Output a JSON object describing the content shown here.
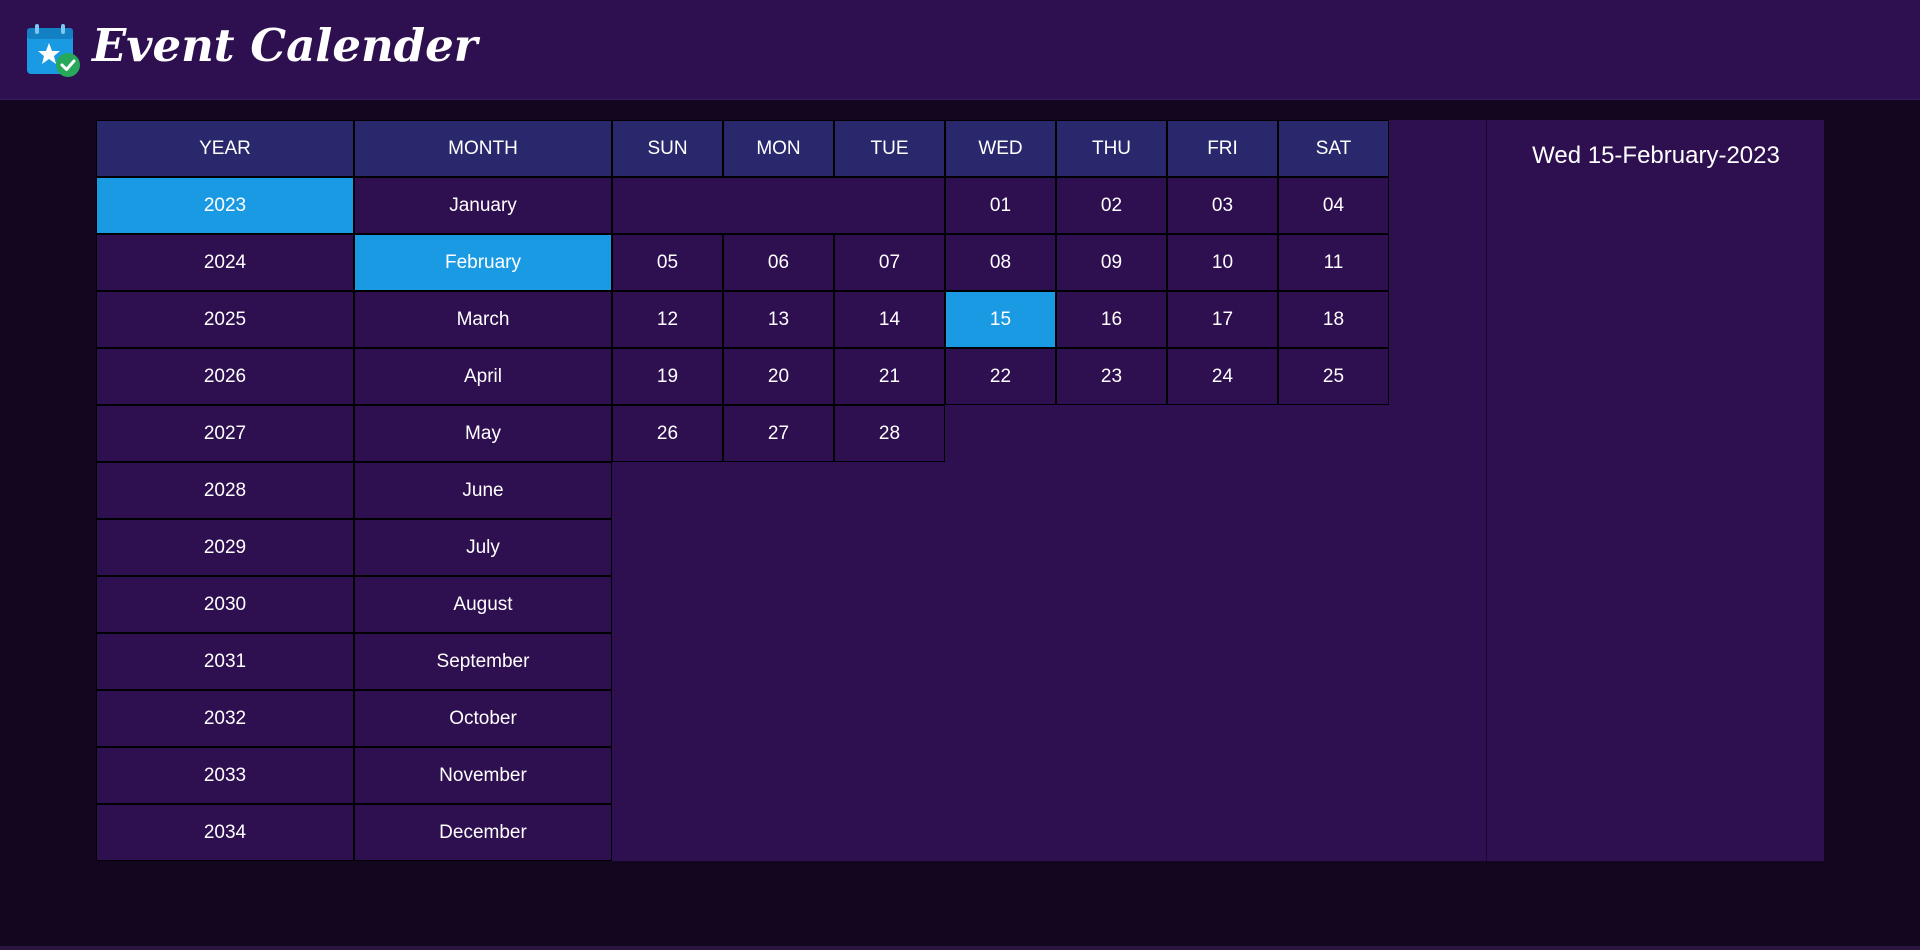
{
  "app": {
    "title": "Event Calender",
    "logo_icon": "calendar-star-check-icon"
  },
  "colors": {
    "page_background": "#13061f",
    "panel_background": "#2e0f50",
    "header_background": "#29286d",
    "selected": "#1b9ae4"
  },
  "year_column": {
    "header": "YEAR",
    "selected": "2023",
    "items": [
      "2023",
      "2024",
      "2025",
      "2026",
      "2027",
      "2028",
      "2029",
      "2030",
      "2031",
      "2032",
      "2033",
      "2034"
    ]
  },
  "month_column": {
    "header": "MONTH",
    "selected": "February",
    "items": [
      "January",
      "February",
      "March",
      "April",
      "May",
      "June",
      "July",
      "August",
      "September",
      "October",
      "November",
      "December"
    ]
  },
  "calendar": {
    "weekdays": [
      "SUN",
      "MON",
      "TUE",
      "WED",
      "THU",
      "FRI",
      "SAT"
    ],
    "first_weekday_index": 3,
    "selected_day": "15",
    "days": [
      "01",
      "02",
      "03",
      "04",
      "05",
      "06",
      "07",
      "08",
      "09",
      "10",
      "11",
      "12",
      "13",
      "14",
      "15",
      "16",
      "17",
      "18",
      "19",
      "20",
      "21",
      "22",
      "23",
      "24",
      "25",
      "26",
      "27",
      "28"
    ]
  },
  "info": {
    "selected_date": "Wed 15-February-2023"
  }
}
